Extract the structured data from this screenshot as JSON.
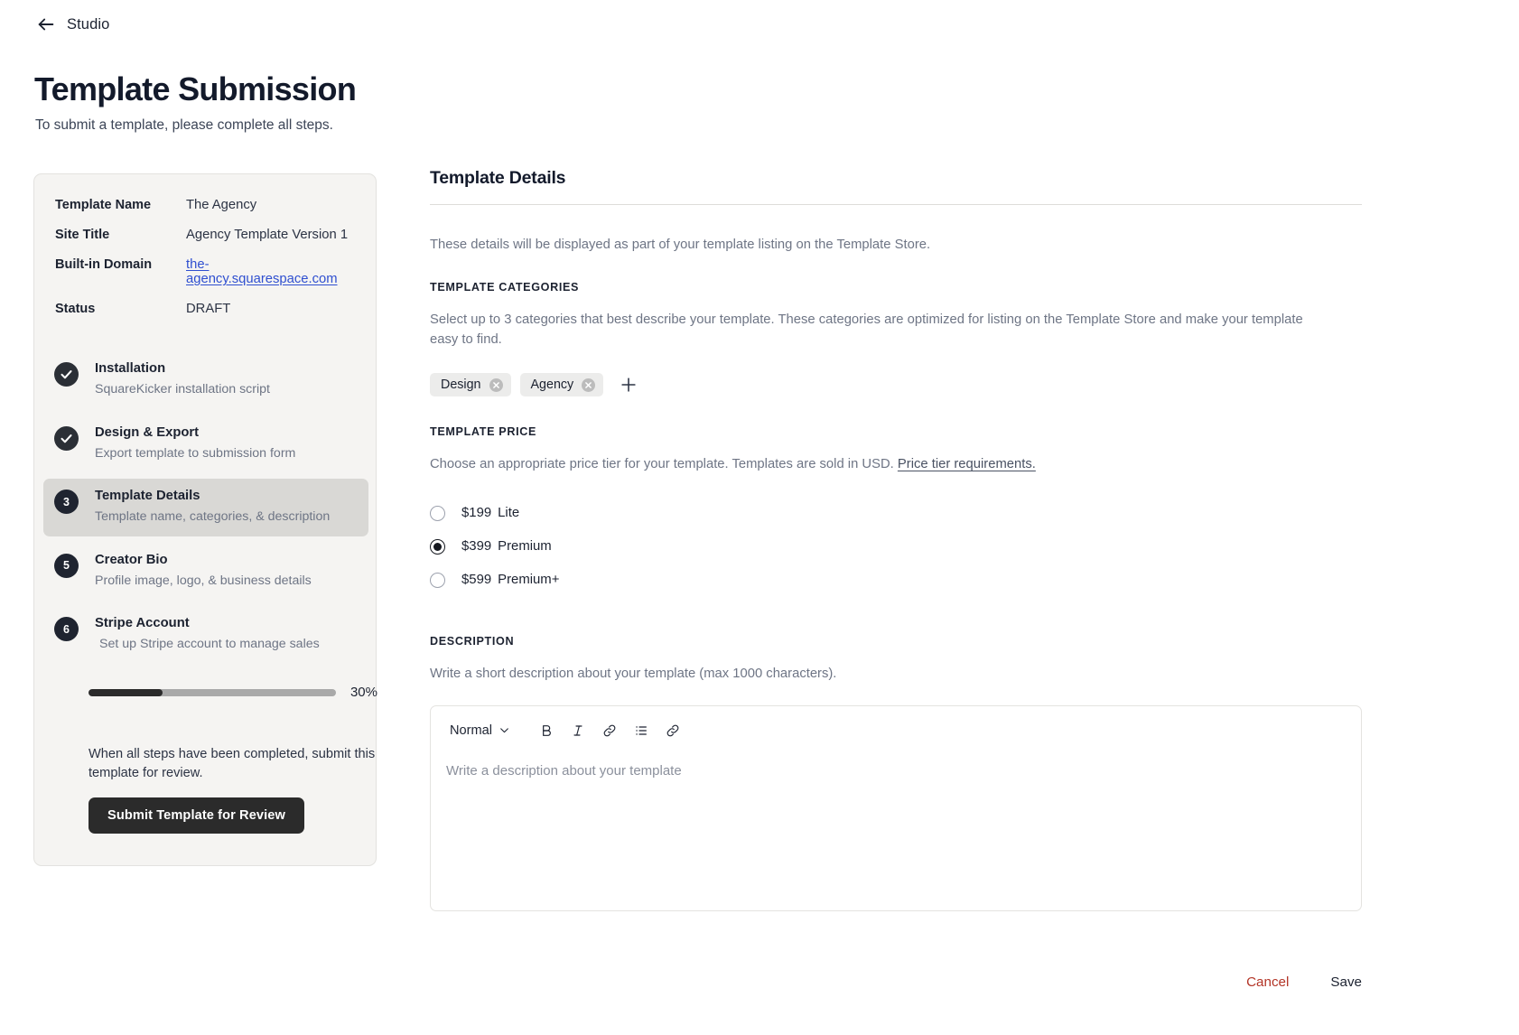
{
  "topbar": {
    "back_label": "Studio",
    "back_icon": "arrow-left-icon"
  },
  "header": {
    "title": "Template Submission",
    "subtitle": "To submit a template, please complete all steps."
  },
  "sidebar": {
    "meta": [
      {
        "key": "Template Name",
        "value": "The Agency",
        "link": false
      },
      {
        "key": "Site Title",
        "value": "Agency Template Version 1",
        "link": false
      },
      {
        "key": "Built-in Domain",
        "value": "the-agency.squarespace.com",
        "link": true
      },
      {
        "key": "Status",
        "value": "DRAFT",
        "link": false
      }
    ],
    "steps": [
      {
        "badge": "check",
        "title": "Installation",
        "desc": "SquareKicker installation script",
        "active": false
      },
      {
        "badge": "check",
        "title": "Design & Export",
        "desc": "Export template to submission form",
        "active": false
      },
      {
        "badge": "3",
        "title": "Template Details",
        "desc": "Template name, categories, & description",
        "active": true
      },
      {
        "badge": "5",
        "title": "Creator Bio",
        "desc": "Profile image, logo, & business details",
        "active": false
      },
      {
        "badge": "6",
        "title": "Stripe Account",
        "desc": "Set up Stripe account to manage sales",
        "active": false
      }
    ],
    "progress": {
      "percent": 30,
      "label": "30%"
    },
    "submit_note": "When all steps have been completed, submit this template for review.",
    "submit_button": "Submit Template for Review"
  },
  "panel": {
    "title": "Template Details",
    "intro": "These details will be displayed as part of your template listing on the Template Store.",
    "categories": {
      "label": "TEMPLATE CATEGORIES",
      "help": "Select up to 3 categories that best describe your template. These categories are optimized for listing on the Template Store and make your template easy to find.",
      "tags": [
        "Design",
        "Agency"
      ],
      "add_icon": "plus-icon"
    },
    "price": {
      "label": "TEMPLATE PRICE",
      "help_before": "Choose an appropriate price tier for your template.  Templates are sold in USD. ",
      "help_link": "Price tier requirements.",
      "options": [
        {
          "price": "$199",
          "tier": "Lite",
          "selected": false
        },
        {
          "price": "$399",
          "tier": "Premium",
          "selected": true
        },
        {
          "price": "$599",
          "tier": "Premium+",
          "selected": false
        }
      ]
    },
    "description": {
      "label": "DESCRIPTION",
      "help": "Write a short description about your template (max 1000 characters).",
      "toolbar": {
        "style_value": "Normal",
        "chevron_icon": "chevron-down-icon",
        "bold": "B",
        "italic": "I",
        "link_icon": "link-icon",
        "list_icon": "bullet-list-icon",
        "link2_icon": "link-icon"
      },
      "placeholder": "Write a description about your template",
      "value": ""
    }
  },
  "footer": {
    "cancel": "Cancel",
    "save": "Save"
  },
  "colors": {
    "accent_dark": "#2b2b2b",
    "link_blue": "#2f4fd0",
    "cancel_red": "#b33426",
    "card_bg": "#f5f4f2",
    "active_step_bg": "#d9d8d5"
  }
}
